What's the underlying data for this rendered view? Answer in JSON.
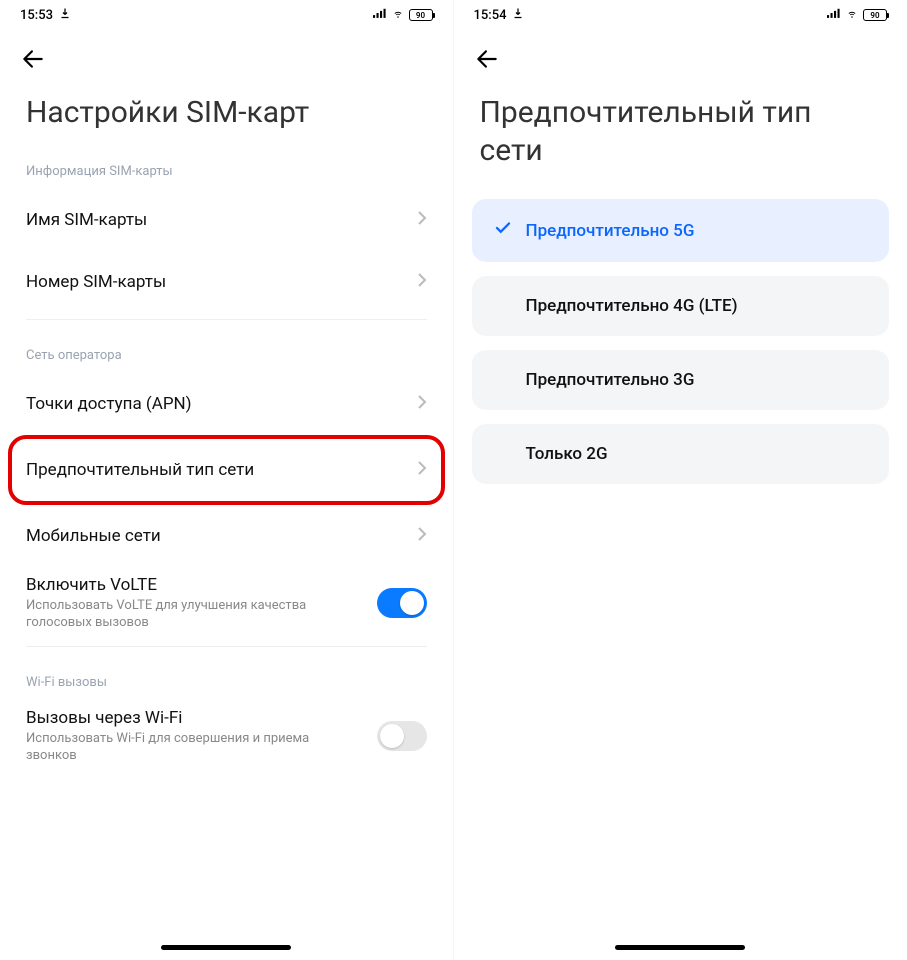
{
  "left": {
    "status": {
      "time": "15:53",
      "battery": "90"
    },
    "title": "Настройки SIM-карт",
    "section1_label": "Информация SIM-карты",
    "sim_name": {
      "label": "Имя SIM-карты",
      "value": "      "
    },
    "sim_number": {
      "label": "Номер SIM-карты",
      "value": "             "
    },
    "section2_label": "Сеть оператора",
    "apn": {
      "label": "Точки доступа (APN)"
    },
    "preferred_net": {
      "label": "Предпочтительный тип сети"
    },
    "mobile_nets": {
      "label": "Мобильные сети"
    },
    "volte": {
      "label": "Включить VoLTE",
      "sub": "Использовать VoLTE для улучшения качества голосовых вызовов"
    },
    "section3_label": "Wi-Fi вызовы",
    "wifi_calls": {
      "label": "Вызовы через Wi-Fi",
      "sub": "Использовать Wi-Fi для совершения и приема звонков"
    }
  },
  "right": {
    "status": {
      "time": "15:54",
      "battery": "90"
    },
    "title": "Предпочтительный тип сети",
    "options": [
      {
        "label": "Предпочтительно 5G",
        "selected": true
      },
      {
        "label": "Предпочтительно 4G (LTE)",
        "selected": false
      },
      {
        "label": "Предпочтительно 3G",
        "selected": false
      },
      {
        "label": "Только 2G",
        "selected": false
      }
    ]
  }
}
